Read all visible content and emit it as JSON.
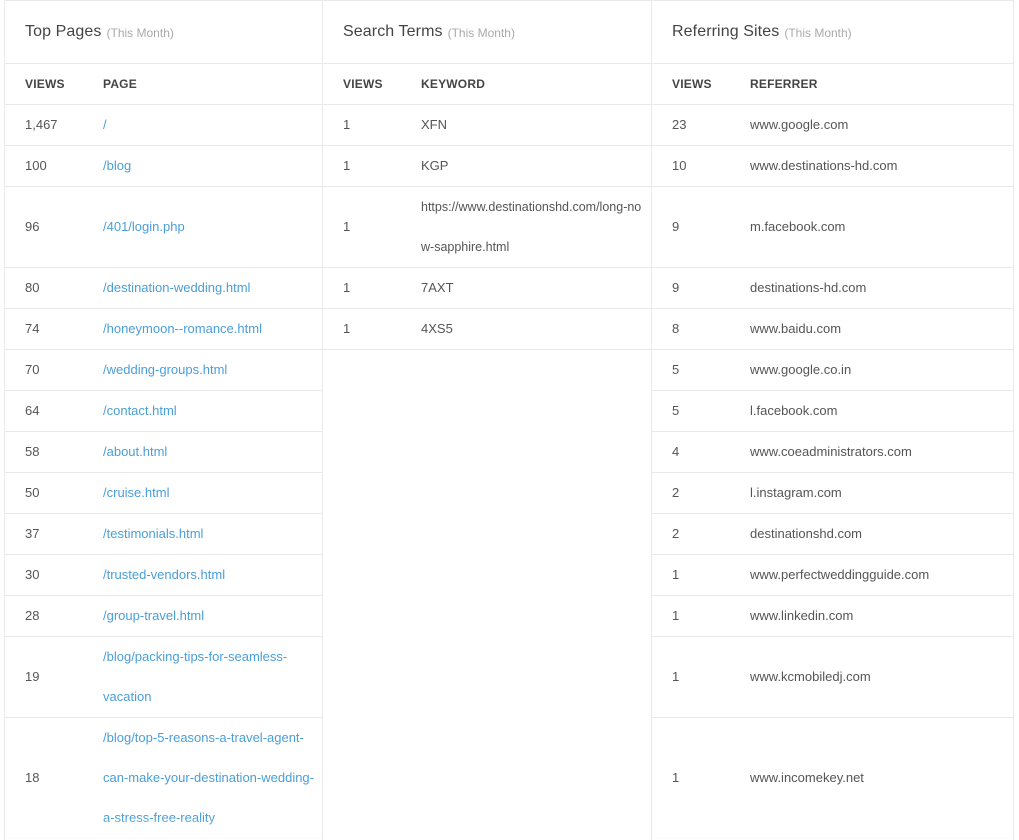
{
  "top_pages": {
    "title": "Top Pages",
    "subtitle": "(This Month)",
    "col_views": "VIEWS",
    "col_page": "PAGE",
    "rows": [
      {
        "views": "1,467",
        "page": "/"
      },
      {
        "views": "100",
        "page": "/blog"
      },
      {
        "views": "96",
        "page": "/401/login.php"
      },
      {
        "views": "80",
        "page": "/destination-wedding.html"
      },
      {
        "views": "74",
        "page": "/honeymoon--romance.html"
      },
      {
        "views": "70",
        "page": "/wedding-groups.html"
      },
      {
        "views": "64",
        "page": "/contact.html"
      },
      {
        "views": "58",
        "page": "/about.html"
      },
      {
        "views": "50",
        "page": "/cruise.html"
      },
      {
        "views": "37",
        "page": "/testimonials.html"
      },
      {
        "views": "30",
        "page": "/trusted-vendors.html"
      },
      {
        "views": "28",
        "page": "/group-travel.html"
      },
      {
        "views": "19",
        "page": "/blog/packing-tips-for-seamless-vacation"
      },
      {
        "views": "18",
        "page": "/blog/top-5-reasons-a-travel-agent-can-make-your-destination-wedding-a-stress-free-reality"
      }
    ]
  },
  "search_terms": {
    "title": "Search Terms",
    "subtitle": "(This Month)",
    "col_views": "VIEWS",
    "col_keyword": "KEYWORD",
    "rows": [
      {
        "views": "1",
        "keyword": "XFN"
      },
      {
        "views": "1",
        "keyword": "KGP"
      },
      {
        "views": "1",
        "keyword": "https://www.destinationshd.com/long-now-sapphire.html"
      },
      {
        "views": "1",
        "keyword": "7AXT"
      },
      {
        "views": "1",
        "keyword": "4XS5"
      }
    ]
  },
  "referring_sites": {
    "title": "Referring Sites",
    "subtitle": "(This Month)",
    "col_views": "VIEWS",
    "col_referrer": "REFERRER",
    "rows": [
      {
        "views": "23",
        "referrer": "www.google.com"
      },
      {
        "views": "10",
        "referrer": "www.destinations-hd.com"
      },
      {
        "views": "9",
        "referrer": "m.facebook.com"
      },
      {
        "views": "9",
        "referrer": "destinations-hd.com"
      },
      {
        "views": "8",
        "referrer": "www.baidu.com"
      },
      {
        "views": "5",
        "referrer": "www.google.co.in"
      },
      {
        "views": "5",
        "referrer": "l.facebook.com"
      },
      {
        "views": "4",
        "referrer": "www.coeadministrators.com"
      },
      {
        "views": "2",
        "referrer": "l.instagram.com"
      },
      {
        "views": "2",
        "referrer": "destinationshd.com"
      },
      {
        "views": "1",
        "referrer": "www.perfectweddingguide.com"
      },
      {
        "views": "1",
        "referrer": "www.linkedin.com"
      },
      {
        "views": "1",
        "referrer": "www.kcmobiledj.com"
      },
      {
        "views": "1",
        "referrer": "www.incomekey.net"
      }
    ]
  }
}
